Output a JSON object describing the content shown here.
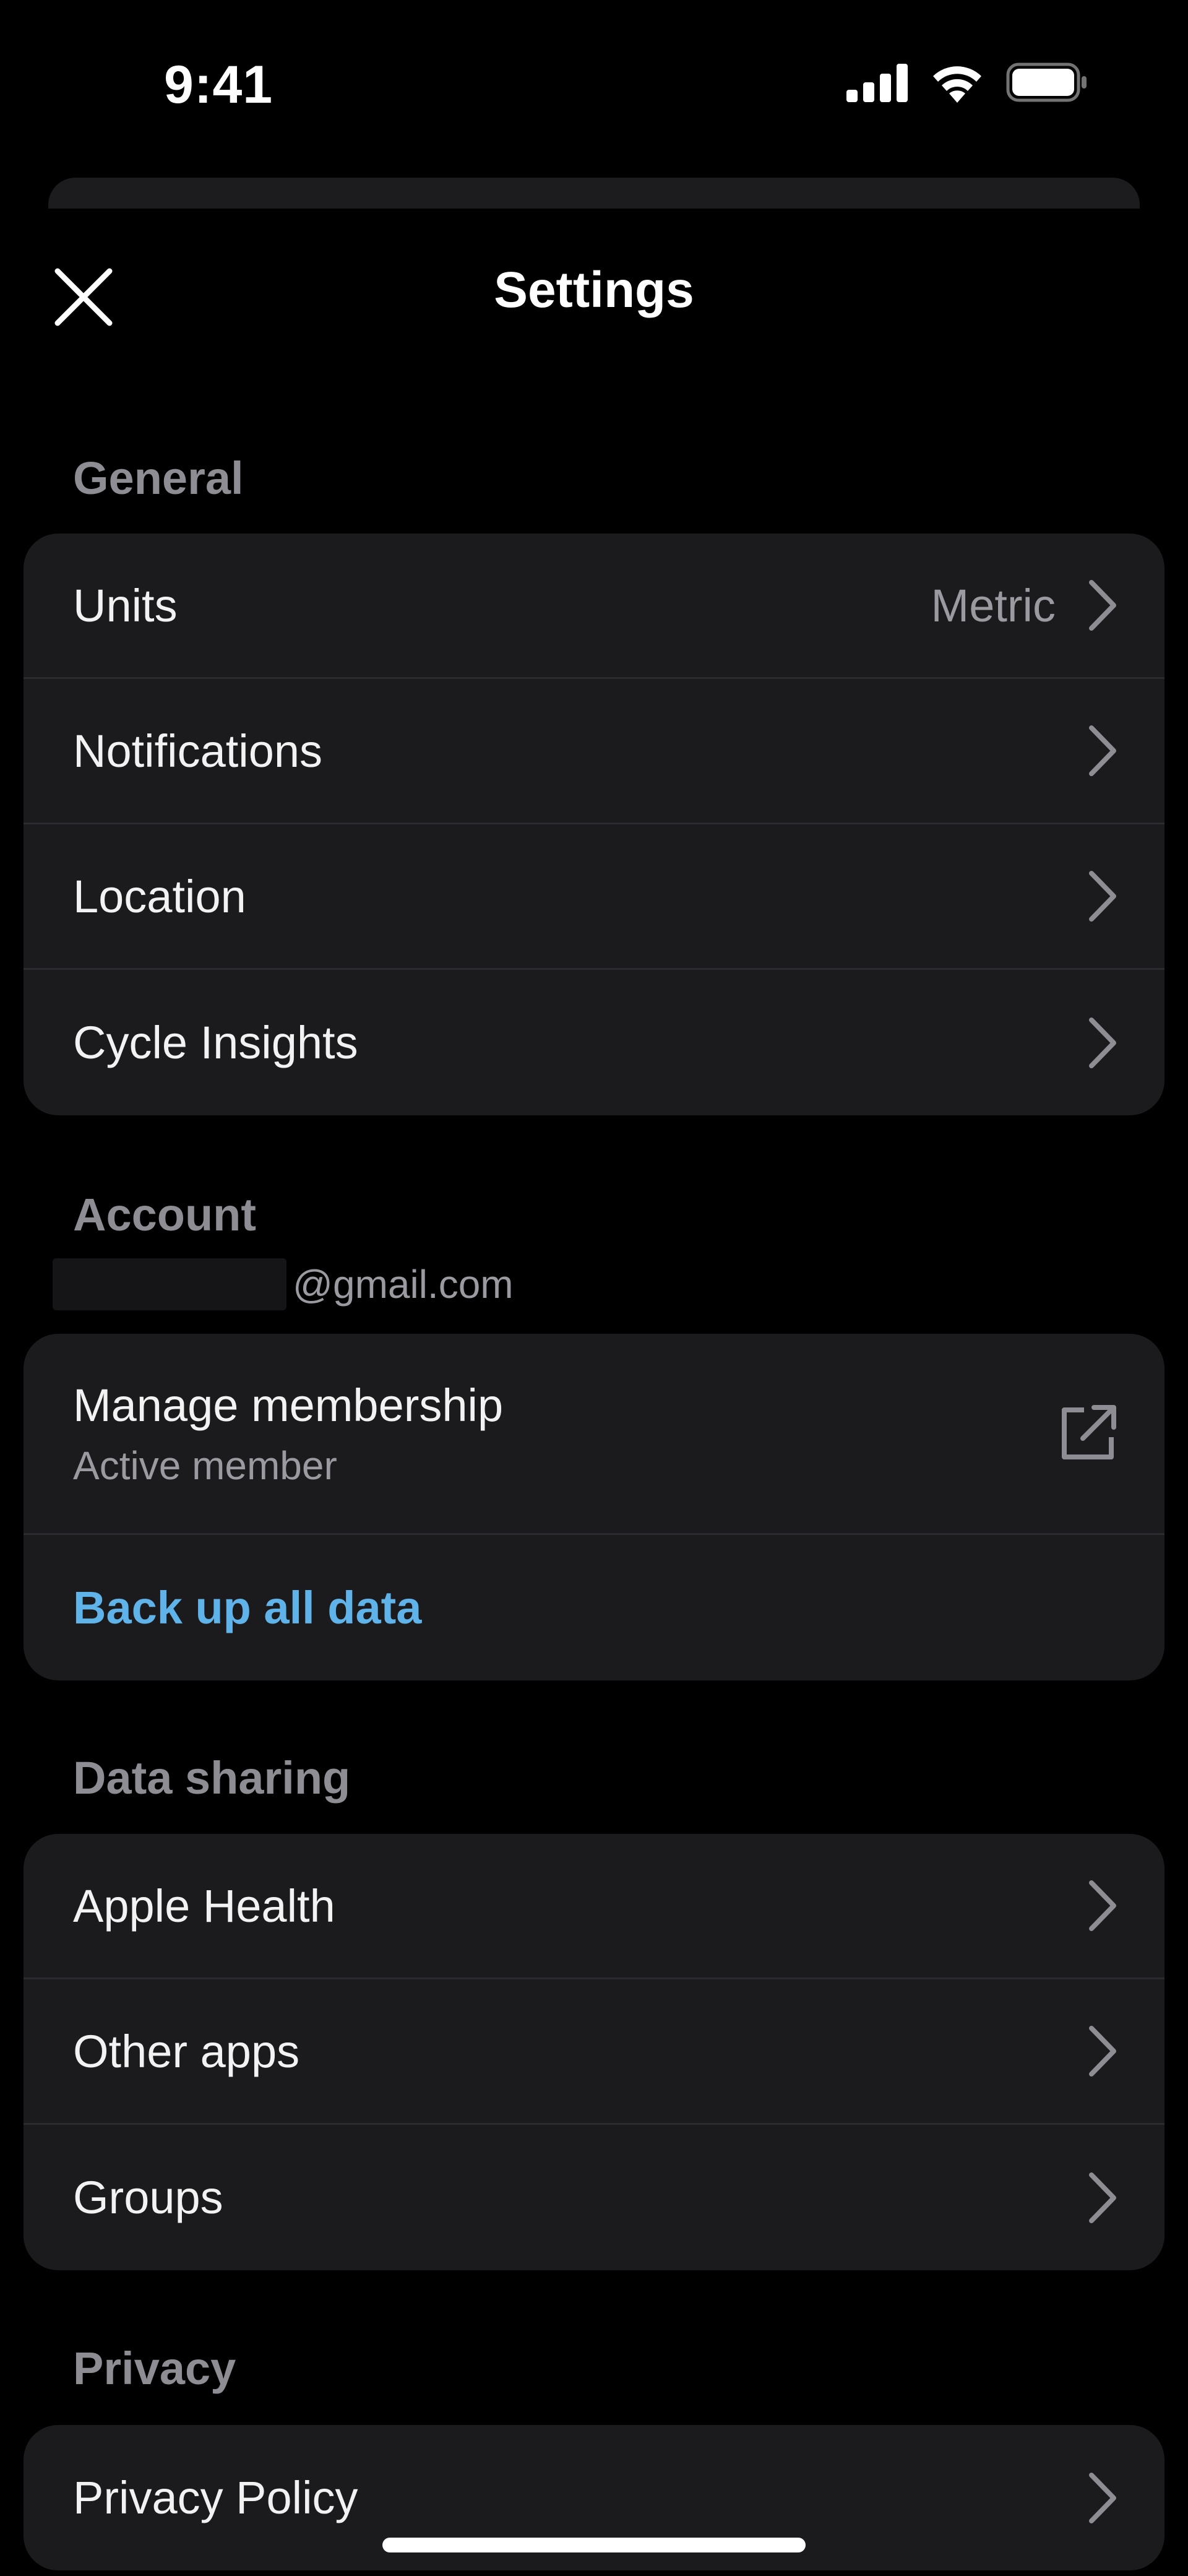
{
  "status_bar": {
    "time": "9:41"
  },
  "header": {
    "title": "Settings"
  },
  "general": {
    "label": "General",
    "items": [
      {
        "label": "Units",
        "value": "Metric"
      },
      {
        "label": "Notifications"
      },
      {
        "label": "Location"
      },
      {
        "label": "Cycle Insights"
      }
    ]
  },
  "account": {
    "label": "Account",
    "email_suffix": "@gmail.com",
    "membership": {
      "label": "Manage membership",
      "status": "Active member"
    },
    "backup_label": "Back up all data"
  },
  "data_sharing": {
    "label": "Data sharing",
    "items": [
      {
        "label": "Apple Health"
      },
      {
        "label": "Other apps"
      },
      {
        "label": "Groups"
      }
    ]
  },
  "privacy": {
    "label": "Privacy",
    "items": [
      {
        "label": "Privacy Policy"
      }
    ]
  },
  "colors": {
    "background": "#000000",
    "card": "#1b1b1e",
    "section_label": "#8d8d93",
    "link_accent": "#5fb3e8"
  },
  "icons": {
    "close": "close-icon",
    "chevron": "chevron-right-icon",
    "external": "external-link-icon",
    "signal": "cellular-signal-icon",
    "wifi": "wifi-icon",
    "battery": "battery-icon"
  }
}
